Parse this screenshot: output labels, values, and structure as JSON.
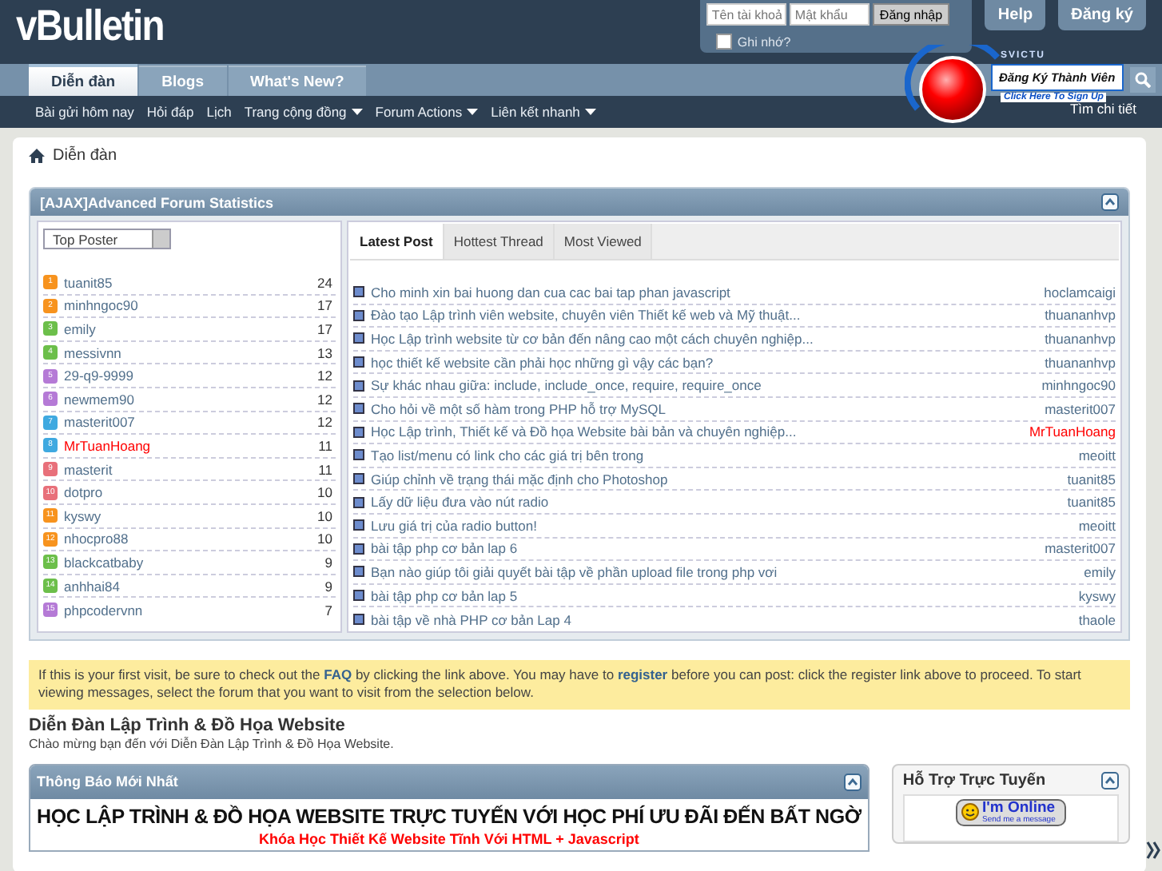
{
  "header": {
    "logo": "vBulletin",
    "username_placeholder": "Tên tài khoả",
    "password_placeholder": "Mật khẩu",
    "login_button": "Đăng nhập",
    "remember": {
      "label": "Ghi nhớ?",
      "checked": false
    },
    "buttons": [
      "Help",
      "Đăng ký"
    ]
  },
  "tabs": [
    {
      "label": "Diễn đàn",
      "selected": true
    },
    {
      "label": "Blogs",
      "selected": false
    },
    {
      "label": "What's New?",
      "selected": false
    }
  ],
  "banner": {
    "tag": "SVICTU",
    "label": "Đăng Ký Thành Viên",
    "sub": "Click Here To Sign Up"
  },
  "subnav": [
    {
      "label": "Bài gửi hôm nay",
      "dropdown": false
    },
    {
      "label": "Hỏi đáp",
      "dropdown": false
    },
    {
      "label": "Lịch",
      "dropdown": false
    },
    {
      "label": "Trang cộng đồng",
      "dropdown": true
    },
    {
      "label": "Forum Actions",
      "dropdown": true
    },
    {
      "label": "Liên kết nhanh",
      "dropdown": true
    }
  ],
  "search_link": "Tìm chi tiết",
  "breadcrumb": "Diễn đàn",
  "stats": {
    "title": "[AJAX]Advanced Forum Statistics",
    "select": "Top Poster",
    "posters": [
      {
        "rank": "1",
        "name": "tuanit85",
        "count": "24",
        "color": "#f7931e",
        "highlighted": false
      },
      {
        "rank": "2",
        "name": "minhngoc90",
        "count": "17",
        "color": "#f7931e",
        "highlighted": false
      },
      {
        "rank": "3",
        "name": "emily",
        "count": "17",
        "color": "#6cbf4a",
        "highlighted": false
      },
      {
        "rank": "4",
        "name": "messivnn",
        "count": "13",
        "color": "#6cbf4a",
        "highlighted": false
      },
      {
        "rank": "5",
        "name": "29-q9-9999",
        "count": "12",
        "color": "#b57ad6",
        "highlighted": false
      },
      {
        "rank": "6",
        "name": "newmem90",
        "count": "12",
        "color": "#b57ad6",
        "highlighted": false
      },
      {
        "rank": "7",
        "name": "masterit007",
        "count": "12",
        "color": "#3fa9e0",
        "highlighted": false
      },
      {
        "rank": "8",
        "name": "MrTuanHoang",
        "count": "11",
        "color": "#3fa9e0",
        "highlighted": true
      },
      {
        "rank": "9",
        "name": "masterit",
        "count": "11",
        "color": "#e8707a",
        "highlighted": false
      },
      {
        "rank": "10",
        "name": "dotpro",
        "count": "10",
        "color": "#e8707a",
        "highlighted": false
      },
      {
        "rank": "11",
        "name": "kyswy",
        "count": "10",
        "color": "#f7931e",
        "highlighted": false
      },
      {
        "rank": "12",
        "name": "nhocpro88",
        "count": "10",
        "color": "#f7931e",
        "highlighted": false
      },
      {
        "rank": "13",
        "name": "blackcatbaby",
        "count": "9",
        "color": "#6cbf4a",
        "highlighted": false
      },
      {
        "rank": "14",
        "name": "anhhai84",
        "count": "9",
        "color": "#6cbf4a",
        "highlighted": false
      },
      {
        "rank": "15",
        "name": "phpcodervnn",
        "count": "7",
        "color": "#b57ad6",
        "highlighted": false
      }
    ],
    "tabs": [
      {
        "label": "Latest Post",
        "selected": true
      },
      {
        "label": "Hottest Thread",
        "selected": false
      },
      {
        "label": "Most Viewed",
        "selected": false
      }
    ],
    "posts": [
      {
        "title": "Cho minh xin bai huong dan cua cac bai tap phan javascript",
        "author": "hoclamcaigi",
        "highlighted": false
      },
      {
        "title": "Đào tạo Lập trình viên website, chuyên viên Thiết kế web và Mỹ thuật...",
        "author": "thuananhvp",
        "highlighted": false
      },
      {
        "title": "Học Lập trình website từ cơ bản đến nâng cao một cách chuyên nghiệp...",
        "author": "thuananhvp",
        "highlighted": false
      },
      {
        "title": "học thiết kế website cần phải học những gì vậy các bạn?",
        "author": "thuananhvp",
        "highlighted": false
      },
      {
        "title": "Sự khác nhau giữa: include, include_once, require, require_once",
        "author": "minhngoc90",
        "highlighted": false
      },
      {
        "title": "Cho hỏi về một số hàm trong PHP hỗ trợ MySQL",
        "author": "masterit007",
        "highlighted": false
      },
      {
        "title": "Học Lập trình, Thiết kế và Đồ họa Website bài bản và chuyên nghiệp...",
        "author": "MrTuanHoang",
        "highlighted": true
      },
      {
        "title": "Tạo list/menu có link cho các giá trị bên trong",
        "author": "meoitt",
        "highlighted": false
      },
      {
        "title": "Giúp chỉnh về trạng thái mặc định cho Photoshop",
        "author": "tuanit85",
        "highlighted": false
      },
      {
        "title": "Lấy dữ liệu đưa vào nút radio",
        "author": "tuanit85",
        "highlighted": false
      },
      {
        "title": "Lưu giá trị của radio button!",
        "author": "meoitt",
        "highlighted": false
      },
      {
        "title": "bài tập php cơ bản lap 6",
        "author": "masterit007",
        "highlighted": false
      },
      {
        "title": "Bạn nào giúp tôi giải quyết bài tập về phần upload file trong php vơi",
        "author": "emily",
        "highlighted": false
      },
      {
        "title": "bài tập php cơ bản lap 5",
        "author": "kyswy",
        "highlighted": false
      },
      {
        "title": "bài tập về nhà PHP cơ bản Lap 4",
        "author": "thaole",
        "highlighted": false
      }
    ]
  },
  "notice": {
    "before": "If this is your first visit, be sure to check out the",
    "faq": "FAQ",
    "middle": "by clicking the link above. You may have to",
    "register": "register",
    "after": "before you can post: click the register link above to proceed. To start viewing messages, select the forum that you want to visit from the selection below."
  },
  "forum": {
    "title": "Diễn Đàn Lập Trình & Đồ Họa Website",
    "subtitle": "Chào mừng bạn đến với Diễn Đàn Lập Trình & Đồ Họa Website."
  },
  "announcements": {
    "title": "Thông Báo Mới Nhất",
    "headline": "HỌC LẬP TRÌNH & ĐỒ HỌA WEBSITE TRỰC TUYẾN VỚI HỌC PHÍ ƯU ĐÃI ĐẾN BẤT NGỜ",
    "link": "Khóa Học Thiết Kế Website Tĩnh Với HTML + Javascript"
  },
  "support": {
    "title": "Hỗ Trợ Trực Tuyến",
    "status": "I'm Online",
    "status_sub": "Send me a message"
  }
}
